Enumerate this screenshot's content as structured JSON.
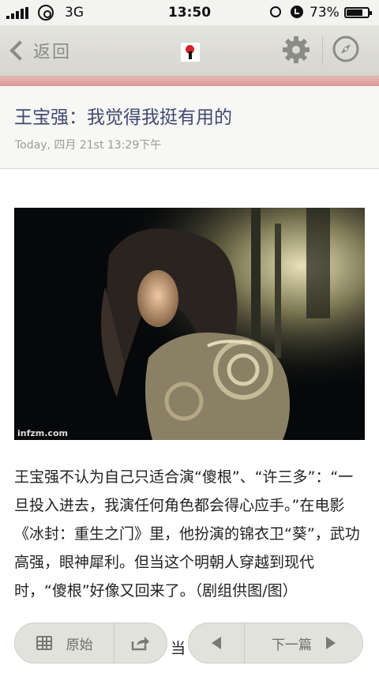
{
  "status_bar": {
    "network": "3G",
    "time": "13:50",
    "battery": "73%"
  },
  "nav": {
    "back_label": "返回",
    "icons": [
      "back-chevron-icon",
      "app-logo-icon",
      "gear-icon",
      "compass-icon"
    ]
  },
  "article": {
    "title": "王宝强：我觉得我挺有用的",
    "date": "Today, 四月 21st 13:29下午",
    "image_watermark": "infzm.com",
    "paragraph1": "王宝强不认为自己只适合演“傻根”、“许三多”：“一旦投入进去，我演任何角色都会得心应手。”在电影《冰封：重生之门》里，他扮演的锦衣卫“葵”，武功高强，眼神犀利。但当这个明朝人穿越到现代时，“傻根”好像又回来了。（剧组供图/图）",
    "paragraph2_partial": "当"
  },
  "toolbar": {
    "original_label": "原始",
    "next_label": "下一篇",
    "icons": [
      "grid-icon",
      "share-icon",
      "prev-arrow-icon",
      "next-arrow-icon"
    ]
  },
  "colors": {
    "title": "#40496e",
    "accent_strip": "#e2a8a6",
    "navbar": "#dcdcd5"
  }
}
